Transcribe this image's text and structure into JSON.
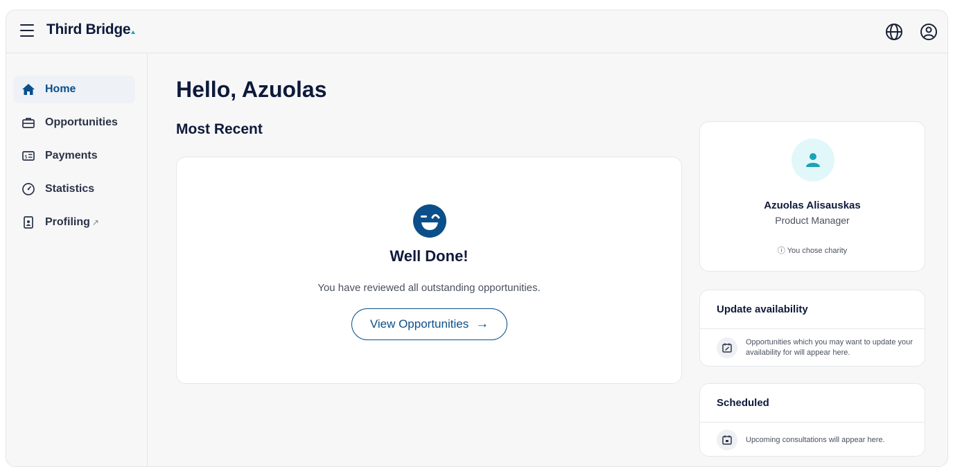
{
  "header": {
    "brand": "Third Bridge",
    "icons": [
      "globe-icon",
      "user-circle-icon"
    ]
  },
  "sidebar": {
    "items": [
      {
        "label": "Home",
        "icon": "home-icon",
        "active": true
      },
      {
        "label": "Opportunities",
        "icon": "briefcase-icon"
      },
      {
        "label": "Payments",
        "icon": "payments-icon"
      },
      {
        "label": "Statistics",
        "icon": "gauge-icon"
      },
      {
        "label": "Profiling",
        "icon": "profile-doc-icon",
        "external": true
      }
    ]
  },
  "main": {
    "greeting": "Hello, Azuolas",
    "section_title": "Most Recent",
    "empty_state": {
      "icon": "wink-face-icon",
      "title": "Well Done!",
      "message": "You have reviewed all outstanding opportunities.",
      "button_label": "View Opportunities"
    }
  },
  "profile": {
    "name": "Azuolas Alisauskas",
    "role": "Product Manager",
    "charity_note": "You chose charity"
  },
  "availability": {
    "title": "Update availability",
    "message": "Opportunities which you may want to update your availability for will appear here."
  },
  "scheduled": {
    "title": "Scheduled",
    "message": "Upcoming consultations will appear here."
  },
  "colors": {
    "accent": "#0b4f8a",
    "teal": "#1aa3b5",
    "background": "#f7f7f8"
  }
}
